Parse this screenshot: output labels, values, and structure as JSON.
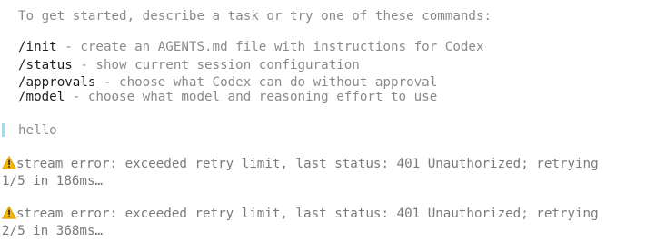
{
  "intro": {
    "text": "To get started, describe a task or try one of these commands:"
  },
  "commands": [
    {
      "name": "/init",
      "description": " - create an AGENTS.md file with instructions for Codex"
    },
    {
      "name": "/status",
      "description": " - show current session configuration"
    },
    {
      "name": "/approvals",
      "description": " - choose what Codex can do without approval"
    },
    {
      "name": "/model",
      "description": " - choose what model and reasoning effort to use"
    }
  ],
  "user_message": {
    "text": "hello"
  },
  "errors": [
    {
      "icon": "warning-icon",
      "line1": "stream error: exceeded retry limit, last status: 401 Unauthorized; retrying",
      "line2": "1/5 in 186ms…"
    },
    {
      "icon": "warning-icon",
      "line1": "stream error: exceeded retry limit, last status: 401 Unauthorized; retrying",
      "line2": "2/5 in 368ms…"
    }
  ],
  "colors": {
    "muted_text": "#8a8a8a",
    "command_text": "#1f1f1f",
    "user_bar": "#a9d9e6",
    "warning": "#f2b705"
  }
}
